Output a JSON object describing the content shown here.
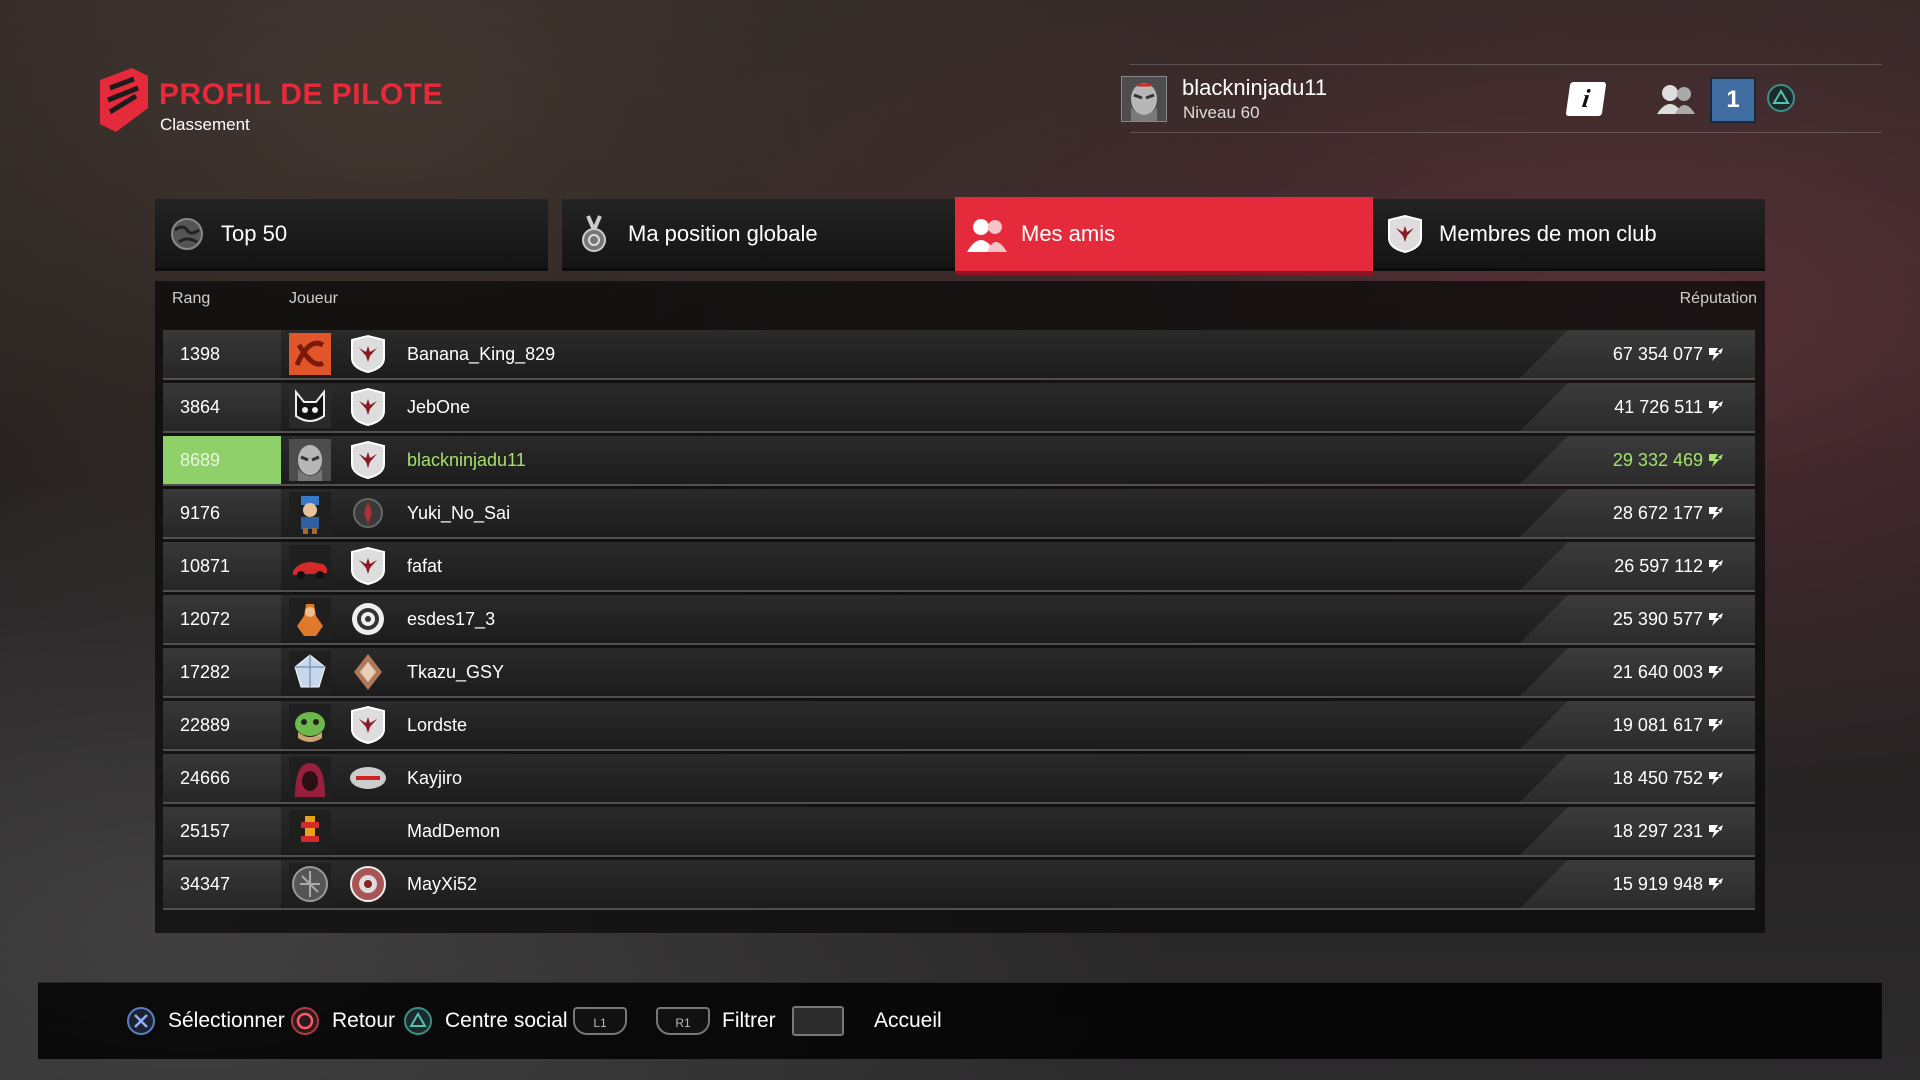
{
  "header": {
    "title": "PROFIL DE PILOTE",
    "subtitle": "Classement",
    "user_name": "blackninjadu11",
    "user_level": "Niveau 60",
    "notification_count": "1"
  },
  "tabs": [
    {
      "label": "Top 50",
      "icon": "globe-icon",
      "active": false
    },
    {
      "label": "Ma position globale",
      "icon": "medal-icon",
      "active": false
    },
    {
      "label": "Mes amis",
      "icon": "friends-icon",
      "active": true
    },
    {
      "label": "Membres de mon club",
      "icon": "club-emblem-icon",
      "active": false
    }
  ],
  "table": {
    "columns": {
      "rank": "Rang",
      "player": "Joueur",
      "reputation": "Réputation"
    },
    "rows": [
      {
        "rank": "1398",
        "player": "Banana_King_829",
        "reputation": "67 354 077"
      },
      {
        "rank": "3864",
        "player": "JebOne",
        "reputation": "41 726 511"
      },
      {
        "rank": "8689",
        "player": "blackninjadu11",
        "reputation": "29 332 469",
        "highlight": true
      },
      {
        "rank": "9176",
        "player": "Yuki_No_Sai",
        "reputation": "28 672 177"
      },
      {
        "rank": "10871",
        "player": "fafat",
        "reputation": "26 597 112"
      },
      {
        "rank": "12072",
        "player": "esdes17_3",
        "reputation": "25 390 577"
      },
      {
        "rank": "17282",
        "player": "Tkazu_GSY",
        "reputation": "21 640 003"
      },
      {
        "rank": "22889",
        "player": "Lordste",
        "reputation": "19 081 617"
      },
      {
        "rank": "24666",
        "player": "Kayjiro",
        "reputation": "18 450 752"
      },
      {
        "rank": "25157",
        "player": "MadDemon",
        "reputation": "18 297 231"
      },
      {
        "rank": "34347",
        "player": "MayXi52",
        "reputation": "15 919 948"
      }
    ]
  },
  "footer": {
    "select": "Sélectionner",
    "back": "Retour",
    "social": "Centre social",
    "l1": "L1",
    "r1": "R1",
    "filter": "Filtrer",
    "home": "Accueil"
  },
  "colors": {
    "accent": "#e52b3b",
    "highlight": "#8fd06a",
    "badge": "#3f6da1"
  }
}
